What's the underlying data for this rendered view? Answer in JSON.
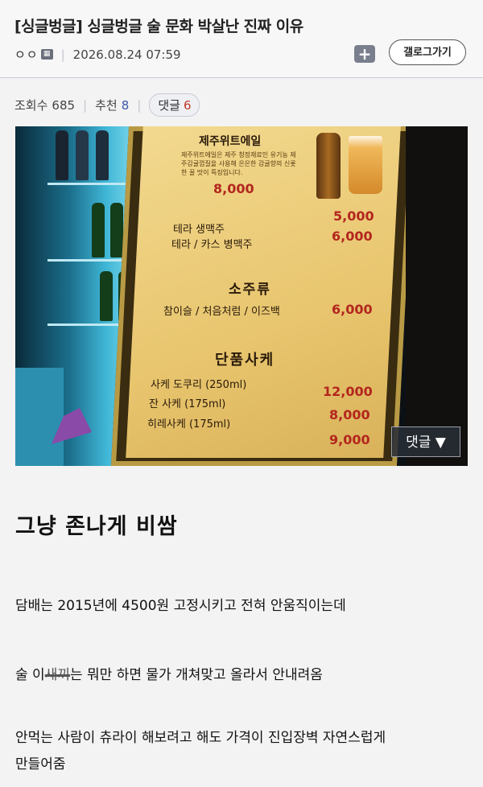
{
  "post": {
    "title": "[싱글벙글] 싱글벙글 술 문화 박살난 진짜 이유",
    "author": "ㅇㅇ",
    "date": "2026.08.24 07:59",
    "gallery_button": "갤로그가기",
    "add_icon": "plus-icon"
  },
  "stats": {
    "views_label": "조회수",
    "views": "685",
    "recommend_label": "추천",
    "recommend": "8",
    "comments_label": "댓글",
    "comments": "6"
  },
  "image": {
    "comment_overlay": "댓글 ▼",
    "menu": {
      "ale_title": "제주위트에일",
      "ale_desc": "제주위트에일은 제주 청정재료인 유기농 제주감귤껍질을 사용해 은은한 감귤향의 신롯한 꿀 맛이 특징입니다.",
      "ale_price": "8,000",
      "terra_draft": "테라 생맥주",
      "terra_draft_price": "5,000",
      "bottle_beer": "테라 / 카스 병맥주",
      "bottle_beer_price": "6,000",
      "soju_head": "소주류",
      "soju_items": "참이슬 / 처음처럼 / 이즈백",
      "soju_price": "6,000",
      "sake_head": "단품사케",
      "sake1": "사케 도쿠리 (250ml)",
      "sake1_price": "12,000",
      "sake2": "잔 사케 (175ml)",
      "sake2_price": "8,000",
      "sake3": "히레사케 (175ml)",
      "sake3_price": "9,000"
    }
  },
  "content": {
    "line1": "그냥        존나게 비쌈",
    "line2": "담배는 2015년에 4500원 고정시키고 전혀 안움직이는데",
    "line3_prefix": "술 이",
    "line3_struck": "새끼",
    "line3_suffix": "는 뭐만 하면 물가 개쳐맞고 올라서 안내려옴",
    "line4a": "안먹는 사람이 츄라이 해보려고 해도 가격이 진입장벽 자연스럽게",
    "line4b": "만들어줌"
  }
}
